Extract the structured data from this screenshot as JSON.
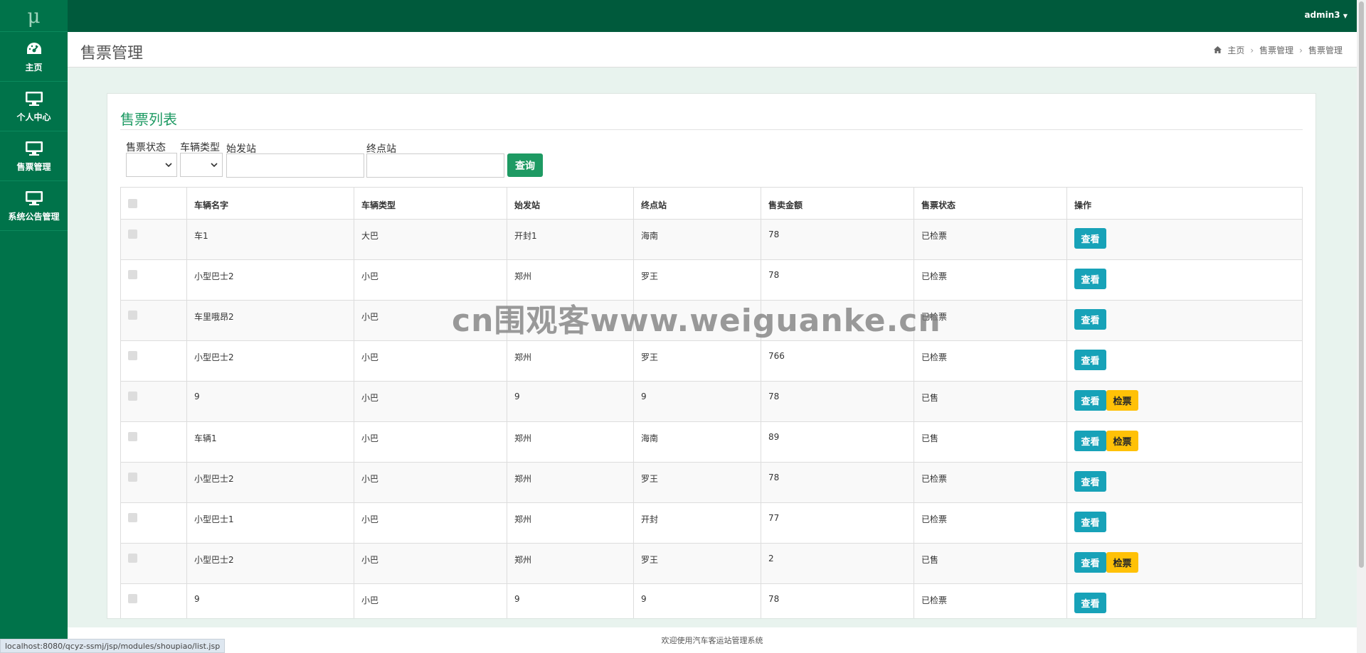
{
  "app": {
    "logo": "μ",
    "user": "admin3"
  },
  "sidebar": {
    "items": [
      {
        "label": "主页",
        "icon": "dashboard-icon"
      },
      {
        "label": "个人中心",
        "icon": "monitor-icon"
      },
      {
        "label": "售票管理",
        "icon": "monitor-icon"
      },
      {
        "label": "系统公告管理",
        "icon": "monitor-icon"
      }
    ]
  },
  "header": {
    "title": "售票管理",
    "breadcrumb": [
      "主页",
      "售票管理",
      "售票管理"
    ]
  },
  "panel": {
    "title": "售票列表",
    "filters": {
      "status_label": "售票状态",
      "type_label": "车辆类型",
      "from_label": "始发站",
      "to_label": "终点站",
      "query_label": "查询"
    }
  },
  "table": {
    "columns": [
      "",
      "车辆名字",
      "车辆类型",
      "始发站",
      "终点站",
      "售卖金额",
      "售票状态",
      "操作"
    ],
    "view_label": "查看",
    "check_label": "检票",
    "rows": [
      {
        "name": "车1",
        "type": "大巴",
        "from": "开封1",
        "to": "海南",
        "amount": "78",
        "status": "已检票",
        "can_check": false
      },
      {
        "name": "小型巴士2",
        "type": "小巴",
        "from": "郑州",
        "to": "罗王",
        "amount": "78",
        "status": "已检票",
        "can_check": false
      },
      {
        "name": "车里哦昂2",
        "type": "小巴",
        "from": "",
        "to": "",
        "amount": "",
        "status": "已检票",
        "can_check": false
      },
      {
        "name": "小型巴士2",
        "type": "小巴",
        "from": "郑州",
        "to": "罗王",
        "amount": "766",
        "status": "已检票",
        "can_check": false
      },
      {
        "name": "9",
        "type": "小巴",
        "from": "9",
        "to": "9",
        "amount": "78",
        "status": "已售",
        "can_check": true
      },
      {
        "name": "车辆1",
        "type": "小巴",
        "from": "郑州",
        "to": "海南",
        "amount": "89",
        "status": "已售",
        "can_check": true
      },
      {
        "name": "小型巴士2",
        "type": "小巴",
        "from": "郑州",
        "to": "罗王",
        "amount": "78",
        "status": "已检票",
        "can_check": false
      },
      {
        "name": "小型巴士1",
        "type": "小巴",
        "from": "郑州",
        "to": "开封",
        "amount": "77",
        "status": "已检票",
        "can_check": false
      },
      {
        "name": "小型巴士2",
        "type": "小巴",
        "from": "郑州",
        "to": "罗王",
        "amount": "2",
        "status": "已售",
        "can_check": true
      },
      {
        "name": "9",
        "type": "小巴",
        "from": "9",
        "to": "9",
        "amount": "78",
        "status": "已检票",
        "can_check": false
      }
    ]
  },
  "footer": {
    "text": "欢迎使用汽车客运站管理系统",
    "status_url": "localhost:8080/qcyz-ssmj/jsp/modules/shoupiao/list.jsp"
  },
  "watermark": "cn围观客www.weiguanke.cn",
  "colors": {
    "sidebar": "#00734a",
    "topbar": "#005a3c",
    "accent": "#1e9a63",
    "view_button": "#17a2b8",
    "check_button": "#ffc107"
  }
}
